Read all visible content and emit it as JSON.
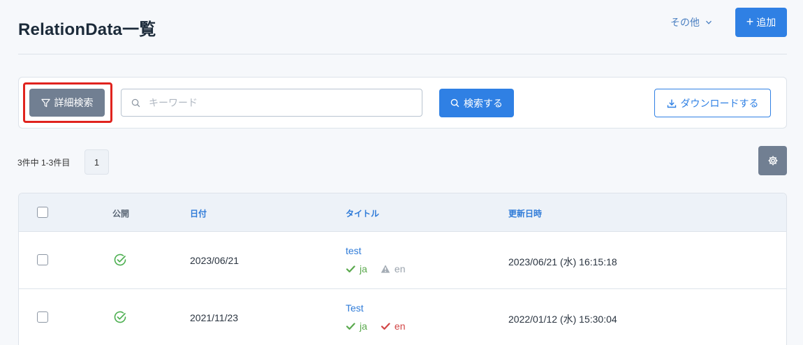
{
  "header": {
    "title": "RelationData一覧",
    "more_label": "その他",
    "add_label": "追加"
  },
  "search": {
    "advanced_label": "詳細検索",
    "placeholder": "キーワード",
    "keyword_value": "",
    "search_label": "検索する",
    "download_label": "ダウンロードする"
  },
  "pagination": {
    "summary": "3件中 1-3件目",
    "current_page": "1"
  },
  "table": {
    "headers": {
      "public": "公開",
      "date": "日付",
      "title": "タイトル",
      "updated": "更新日時"
    },
    "rows": [
      {
        "public": true,
        "date": "2023/06/21",
        "title": "test",
        "lang_ja": "ja",
        "lang_en": "en",
        "lang_ja_status": "ok",
        "lang_en_status": "warning",
        "updated": "2023/06/21 (水) 16:15:18"
      },
      {
        "public": true,
        "date": "2021/11/23",
        "title": "Test",
        "lang_ja": "ja",
        "lang_en": "en",
        "lang_ja_status": "ok",
        "lang_en_status": "error",
        "updated": "2022/01/12 (水) 15:30:04"
      }
    ]
  },
  "colors": {
    "primary": "#2f80e4",
    "secondary": "#717f92",
    "highlight": "#e0231e",
    "ok": "#5aa94d",
    "error": "#d24646"
  }
}
